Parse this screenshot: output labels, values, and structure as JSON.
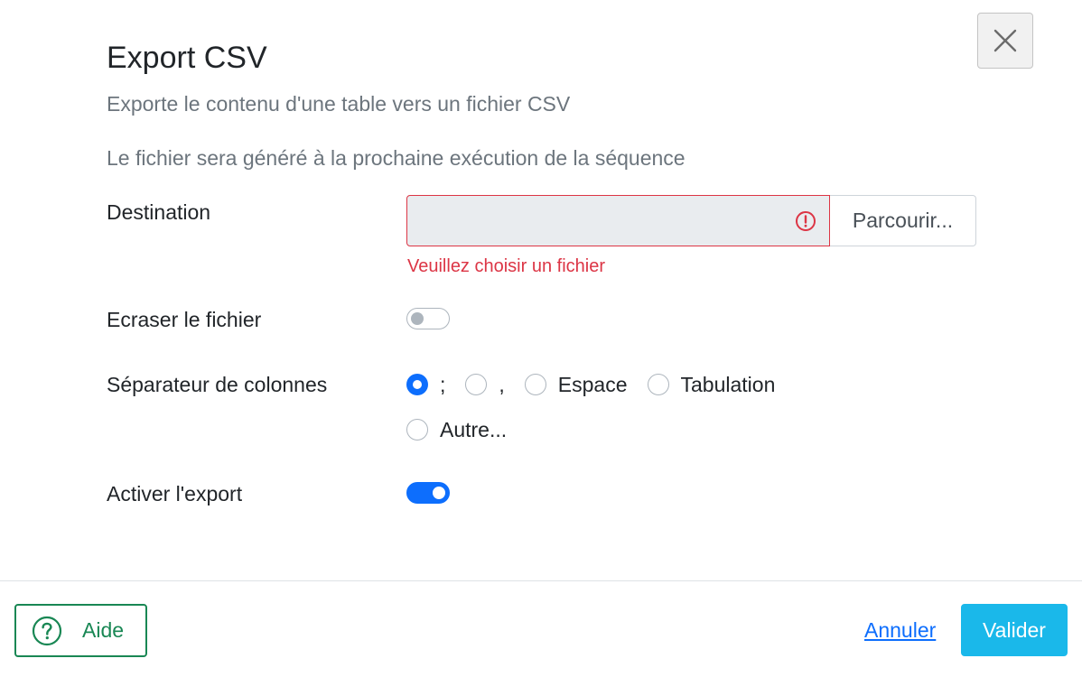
{
  "dialog": {
    "title": "Export CSV",
    "subtitle": "Exporte le contenu d'une table vers un fichier CSV",
    "info": "Le fichier sera généré à la prochaine exécution de la séquence",
    "close_icon": "close-icon"
  },
  "form": {
    "destination": {
      "label": "Destination",
      "value": "",
      "browse_label": "Parcourir...",
      "error_icon": "exclamation-circle-icon",
      "error": "Veuillez choisir un fichier"
    },
    "overwrite": {
      "label": "Ecraser le fichier",
      "checked": false
    },
    "separator": {
      "label": "Séparateur de colonnes",
      "options": [
        {
          "label": ";",
          "checked": true
        },
        {
          "label": ",",
          "checked": false
        },
        {
          "label": "Espace",
          "checked": false
        },
        {
          "label": "Tabulation",
          "checked": false
        },
        {
          "label": "Autre...",
          "checked": false
        }
      ]
    },
    "enable_export": {
      "label": "Activer l'export",
      "checked": true
    }
  },
  "footer": {
    "help_label": "Aide",
    "help_icon": "question-circle-icon",
    "cancel_label": "Annuler",
    "validate_label": "Valider"
  },
  "colors": {
    "primary": "#0d6efd",
    "danger": "#dc3545",
    "success": "#198754",
    "validate": "#1ab8ea"
  }
}
